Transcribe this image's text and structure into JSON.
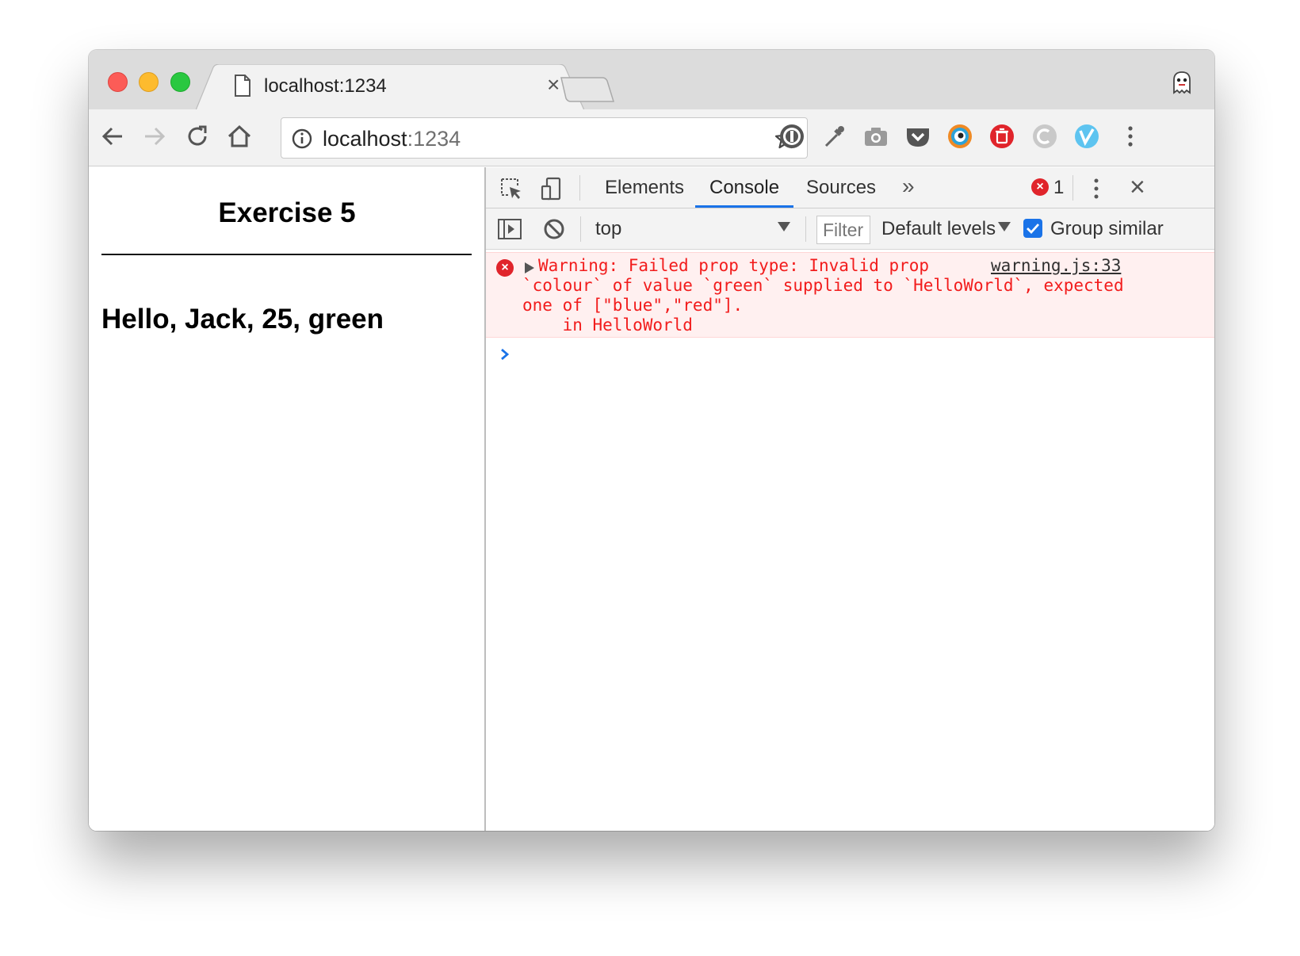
{
  "browser": {
    "tab": {
      "title": "localhost:1234"
    },
    "omnibox": {
      "host": "localhost",
      "port": ":1234"
    }
  },
  "page": {
    "title": "Exercise 5",
    "greeting": "Hello, Jack, 25, green"
  },
  "devtools": {
    "tabs": [
      {
        "label": "Elements"
      },
      {
        "label": "Console",
        "active": true
      },
      {
        "label": "Sources"
      }
    ],
    "more_tabs": "»",
    "error_count": "1",
    "context": "top",
    "filter_placeholder": "Filter",
    "levels_label": "Default levels",
    "group_similar": {
      "label": "Group similar",
      "checked": true
    },
    "messages": [
      {
        "level": "error",
        "text": "Warning: Failed prop type: Invalid prop\n`colour` of value `green` supplied to `HelloWorld`, expected\none of [\"blue\",\"red\"].\n    in HelloWorld",
        "source": "warning.js:33"
      }
    ]
  },
  "colors": {
    "accent": "#1a73e8",
    "error": "#e0242b",
    "error_text": "#f21c1c",
    "error_bg": "#fff0f0"
  }
}
